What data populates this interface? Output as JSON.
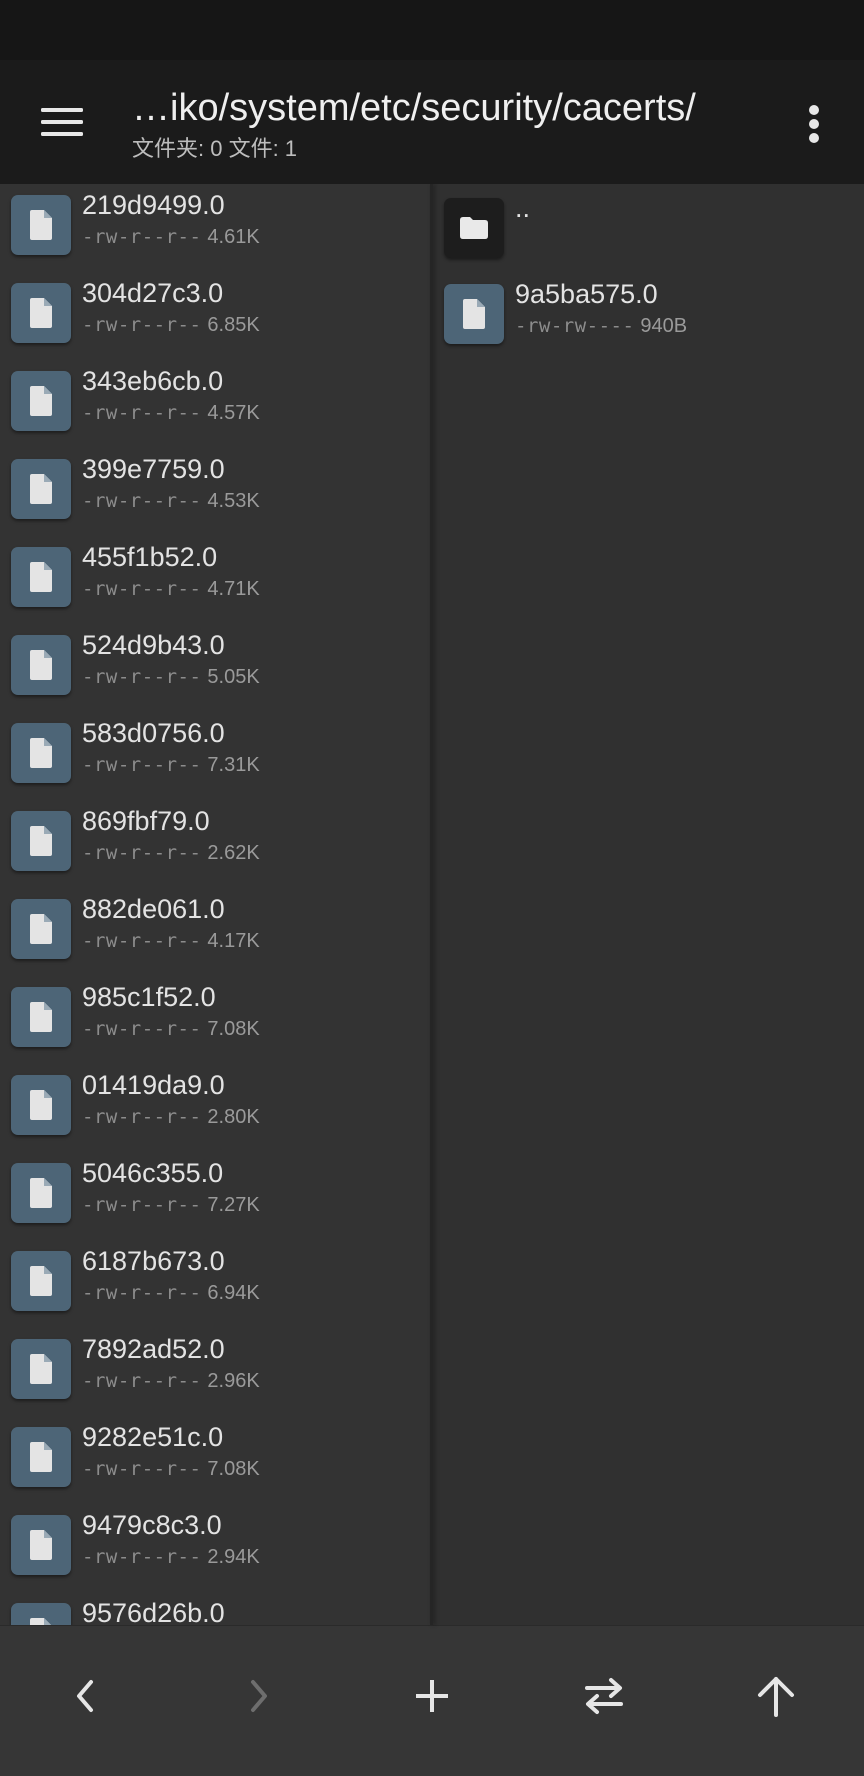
{
  "header": {
    "title": "…iko/system/etc/security/cacerts/",
    "subtitle": "文件夹: 0  文件: 1"
  },
  "left_pane": {
    "files": [
      {
        "name": "219d9499.0",
        "perm": "-rw-r--r--",
        "size": "4.61K"
      },
      {
        "name": "304d27c3.0",
        "perm": "-rw-r--r--",
        "size": "6.85K"
      },
      {
        "name": "343eb6cb.0",
        "perm": "-rw-r--r--",
        "size": "4.57K"
      },
      {
        "name": "399e7759.0",
        "perm": "-rw-r--r--",
        "size": "4.53K"
      },
      {
        "name": "455f1b52.0",
        "perm": "-rw-r--r--",
        "size": "4.71K"
      },
      {
        "name": "524d9b43.0",
        "perm": "-rw-r--r--",
        "size": "5.05K"
      },
      {
        "name": "583d0756.0",
        "perm": "-rw-r--r--",
        "size": "7.31K"
      },
      {
        "name": "869fbf79.0",
        "perm": "-rw-r--r--",
        "size": "2.62K"
      },
      {
        "name": "882de061.0",
        "perm": "-rw-r--r--",
        "size": "4.17K"
      },
      {
        "name": "985c1f52.0",
        "perm": "-rw-r--r--",
        "size": "7.08K"
      },
      {
        "name": "01419da9.0",
        "perm": "-rw-r--r--",
        "size": "2.80K"
      },
      {
        "name": "5046c355.0",
        "perm": "-rw-r--r--",
        "size": "7.27K"
      },
      {
        "name": "6187b673.0",
        "perm": "-rw-r--r--",
        "size": "6.94K"
      },
      {
        "name": "7892ad52.0",
        "perm": "-rw-r--r--",
        "size": "2.96K"
      },
      {
        "name": "9282e51c.0",
        "perm": "-rw-r--r--",
        "size": "7.08K"
      },
      {
        "name": "9479c8c3.0",
        "perm": "-rw-r--r--",
        "size": "2.94K"
      },
      {
        "name": "9576d26b.0",
        "perm": "",
        "size": ""
      }
    ]
  },
  "right_pane": {
    "parent": {
      "name": ".."
    },
    "files": [
      {
        "name": "9a5ba575.0",
        "perm": "-rw-rw----",
        "size": "940B"
      }
    ]
  },
  "icons": {
    "menu": "menu-icon",
    "more": "more-vert-icon",
    "file": "file-icon",
    "folder": "folder-icon",
    "back": "chevron-left-icon",
    "forward": "chevron-right-icon",
    "add": "plus-icon",
    "swap": "swap-icon",
    "up": "arrow-up-icon"
  },
  "colors": {
    "file_icon_bg": "#4d6577",
    "folder_icon_bg": "#1d1d1d",
    "appbar_bg": "#1b1b1b"
  }
}
